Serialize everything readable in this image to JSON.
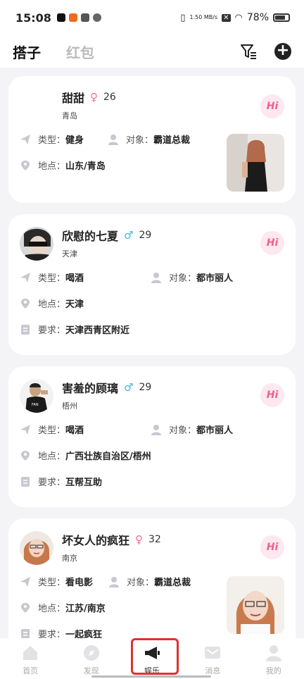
{
  "status_bar": {
    "time": "15:08",
    "speed": "1.50\nMB/s",
    "battery": "78%"
  },
  "header": {
    "tab_active": "搭子",
    "tab_inactive": "红包"
  },
  "cards": [
    {
      "name": "甜甜",
      "gender": "female",
      "gender_symbol": "♀",
      "age": "26",
      "city": "青岛",
      "type_label": "类型：",
      "type_value": "健身",
      "target_label": "对象：",
      "target_value": "霸道总裁",
      "location_label": "地点：",
      "location_value": "山东/青岛",
      "hi": "Hi"
    },
    {
      "name": "欣慰的七夏",
      "gender": "male",
      "gender_symbol": "♂",
      "age": "29",
      "city": "天津",
      "type_label": "类型：",
      "type_value": "喝酒",
      "target_label": "对象：",
      "target_value": "都市丽人",
      "location_label": "地点：",
      "location_value": "天津",
      "req_label": "要求：",
      "req_value": "天津西青区附近",
      "hi": "Hi"
    },
    {
      "name": "害羞的顾璃",
      "gender": "male",
      "gender_symbol": "♂",
      "age": "29",
      "city": "梧州",
      "type_label": "类型：",
      "type_value": "喝酒",
      "target_label": "对象：",
      "target_value": "都市丽人",
      "location_label": "地点：",
      "location_value": "广西壮族自治区/梧州",
      "req_label": "要求：",
      "req_value": "互帮互助",
      "hi": "Hi"
    },
    {
      "name": "坏女人的疯狂",
      "gender": "female",
      "gender_symbol": "♀",
      "age": "32",
      "city": "南京",
      "type_label": "类型：",
      "type_value": "看电影",
      "target_label": "对象：",
      "target_value": "霸道总裁",
      "location_label": "地点：",
      "location_value": "江苏/南京",
      "req_label": "要求：",
      "req_value": "一起疯狂",
      "hi": "Hi"
    }
  ],
  "nav": [
    {
      "label": "首页",
      "icon": "home-icon"
    },
    {
      "label": "发现",
      "icon": "compass-icon"
    },
    {
      "label": "娱乐",
      "icon": "megaphone-icon",
      "active": true
    },
    {
      "label": "消息",
      "icon": "message-icon"
    },
    {
      "label": "我的",
      "icon": "profile-icon"
    }
  ],
  "colors": {
    "female": "#f06c9b",
    "male": "#3fb4e6",
    "hi_bg": "#fde8ef",
    "hi_text": "#ef5f8b",
    "highlight": "#e03030"
  }
}
